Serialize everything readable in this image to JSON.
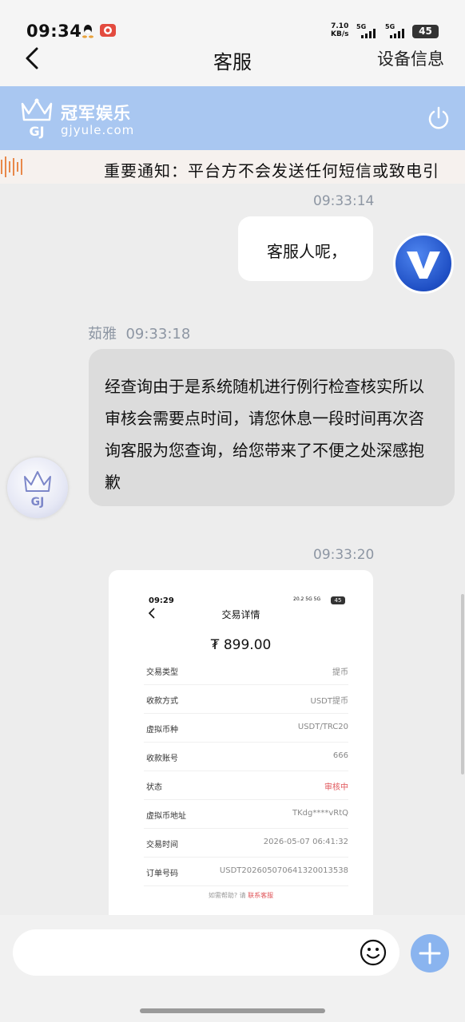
{
  "status_bar": {
    "time": "09:34",
    "net_speed": "7.10",
    "net_unit": "KB/s",
    "sig1": "5G",
    "sig2": "5G",
    "battery": "45"
  },
  "titlebar": {
    "title": "客服",
    "right_label": "设备信息"
  },
  "brand": {
    "name": "冠军娱乐",
    "domain": "gjyule.com",
    "logo_text": "GJ"
  },
  "notice": {
    "text": "重要通知：平台方不会发送任何短信或致电引"
  },
  "chat": {
    "ts1": "09:33:14",
    "user_msg": "客服人呢，",
    "agent_name": "茹雅",
    "ts2": "09:33:18",
    "agent_msg": "经查询由于是系统随机进行例行检查核实所以审核会需要点时间，请您休息一段时间再次咨询客服为您查询，给您带来了不便之处深感抱歉",
    "ts3": "09:33:20",
    "agent_avatar_text": "GJ"
  },
  "screenshot": {
    "time": "09:29",
    "status": "20.2 5G 5G",
    "battery": "45",
    "title": "交易详情",
    "amount": "₮ 899.00",
    "rows": [
      {
        "key": "交易类型",
        "value": "提币"
      },
      {
        "key": "收款方式",
        "value": "USDT提币"
      },
      {
        "key": "虚拟币种",
        "value": "USDT/TRC20"
      },
      {
        "key": "收款账号",
        "value": "666"
      },
      {
        "key": "状态",
        "value": "审核中"
      },
      {
        "key": "虚拟币地址",
        "value": "TKdg****vRtQ"
      },
      {
        "key": "交易时间",
        "value": "2026-05-07 06:41:32"
      },
      {
        "key": "订单号码",
        "value": "USDT20260507064132001353​8"
      }
    ],
    "help_prefix": "如需帮助? 请",
    "help_link": "联系客服"
  },
  "input": {
    "placeholder": ""
  },
  "colors": {
    "brand_bg": "#a9c7f1",
    "plus_button": "#8ab4ef",
    "pending": "#e0575b"
  }
}
